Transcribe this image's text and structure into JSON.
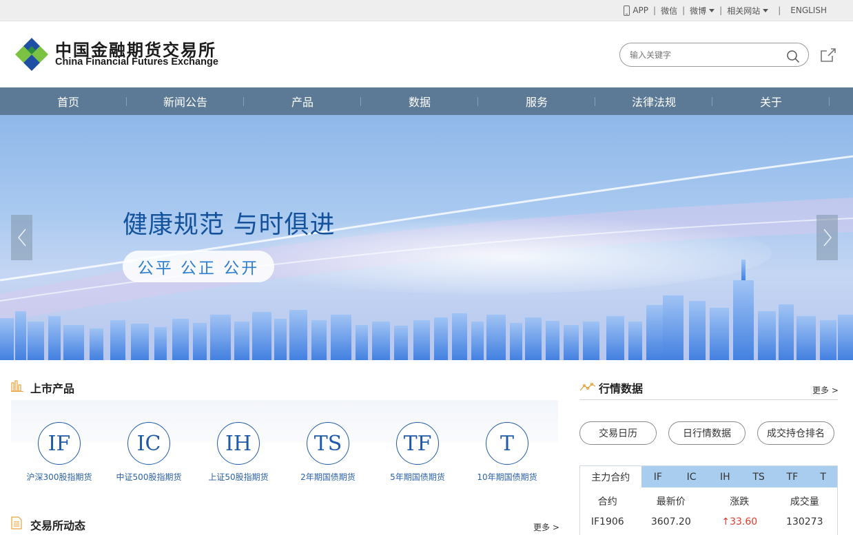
{
  "topbar": {
    "app": "APP",
    "wechat": "微信",
    "weibo": "微博",
    "related": "相关网站",
    "english": "ENGLISH"
  },
  "header": {
    "logo_cn": "中国金融期货交易所",
    "logo_en": "China Financial Futures Exchange",
    "search_placeholder": "输入关键字"
  },
  "nav": [
    "首页",
    "新闻公告",
    "产品",
    "数据",
    "服务",
    "法律法规",
    "关于"
  ],
  "banner": {
    "slogan": "健康规范  与时俱进",
    "pill": "公平  公正  公开"
  },
  "products": {
    "title": "上市产品",
    "items": [
      {
        "code": "IF",
        "label": "沪深300股指期货"
      },
      {
        "code": "IC",
        "label": "中证500股指期货"
      },
      {
        "code": "IH",
        "label": "上证50股指期货"
      },
      {
        "code": "TS",
        "label": "2年期国债期货"
      },
      {
        "code": "TF",
        "label": "5年期国债期货"
      },
      {
        "code": "T",
        "label": "10年期国债期货"
      }
    ]
  },
  "news": {
    "title": "交易所动态",
    "more": "更多 >"
  },
  "market": {
    "title": "行情数据",
    "more": "更多 >",
    "buttons": [
      "交易日历",
      "日行情数据",
      "成交持仓排名"
    ],
    "tabs": [
      "主力合约",
      "IF",
      "IC",
      "IH",
      "TS",
      "TF",
      "T"
    ],
    "columns": [
      "合约",
      "最新价",
      "涨跌",
      "成交量"
    ],
    "row": {
      "contract": "IF1906",
      "price": "3607.20",
      "change": "↑33.60",
      "volume": "130273"
    }
  },
  "colors": {
    "nav_bg": "#5c7996",
    "brand_blue": "#1e5aa8",
    "accent_orange": "#e8a33d",
    "up_red": "#e23a2d",
    "tab_bg": "#a9cdee"
  }
}
